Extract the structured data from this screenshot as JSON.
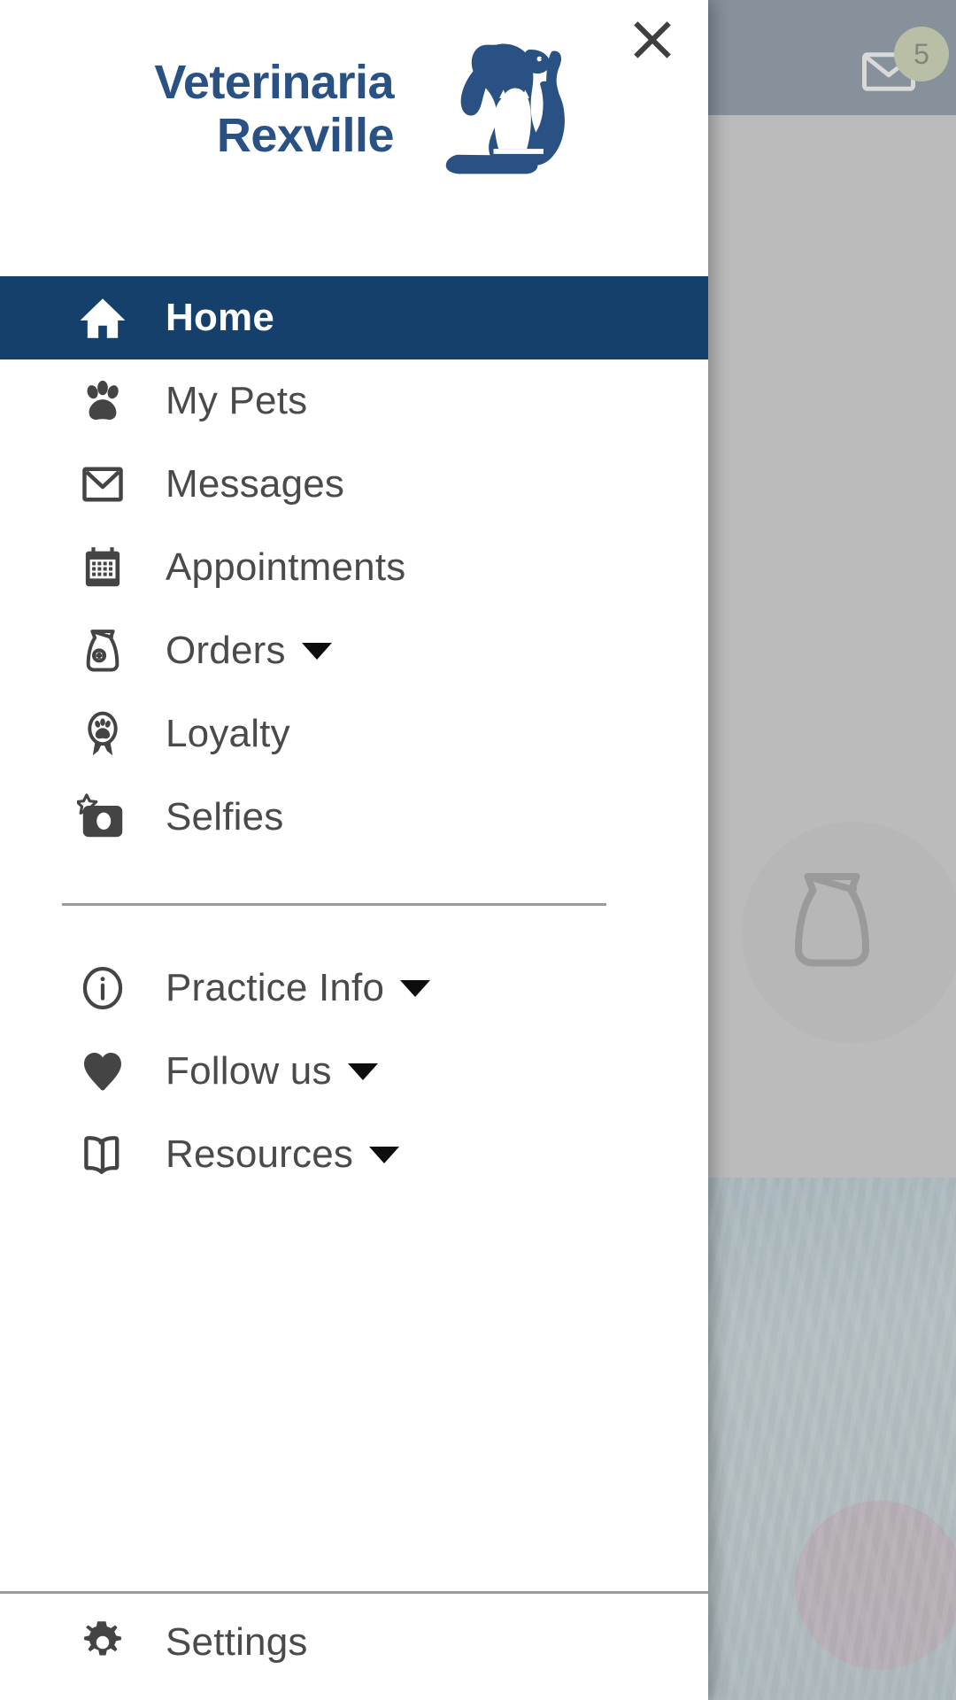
{
  "background_app": {
    "mail_icon": "envelope-icon",
    "unread_badge": "5",
    "appbar_color": "#687c8f",
    "scrim_color": "#aaaaaa"
  },
  "drawer": {
    "logo": {
      "text": "Veterinaria\nRexville",
      "mark": "dog-cat-bird-logo",
      "color": "#2a5184"
    },
    "close_button": {
      "icon": "close-icon",
      "label": "Close"
    },
    "accent_color": "#14406b",
    "item_text_color": "#4a4a4a",
    "primary_items": [
      {
        "label": "Home",
        "icon": "home-icon",
        "selected": true,
        "expandable": false
      },
      {
        "label": "My Pets",
        "icon": "paw-icon",
        "selected": false,
        "expandable": false
      },
      {
        "label": "Messages",
        "icon": "envelope-icon",
        "selected": false,
        "expandable": false
      },
      {
        "label": "Appointments",
        "icon": "calendar-icon",
        "selected": false,
        "expandable": false
      },
      {
        "label": "Orders",
        "icon": "food-bag-icon",
        "selected": false,
        "expandable": true
      },
      {
        "label": "Loyalty",
        "icon": "award-paw-icon",
        "selected": false,
        "expandable": false
      },
      {
        "label": "Selfies",
        "icon": "camera-star-icon",
        "selected": false,
        "expandable": false
      }
    ],
    "secondary_items": [
      {
        "label": "Practice Info",
        "icon": "info-circle-icon",
        "selected": false,
        "expandable": true
      },
      {
        "label": "Follow us",
        "icon": "heart-icon",
        "selected": false,
        "expandable": true
      },
      {
        "label": "Resources",
        "icon": "book-icon",
        "selected": false,
        "expandable": true
      }
    ],
    "footer_items": [
      {
        "label": "Settings",
        "icon": "gear-icon",
        "selected": false,
        "expandable": false
      }
    ]
  }
}
